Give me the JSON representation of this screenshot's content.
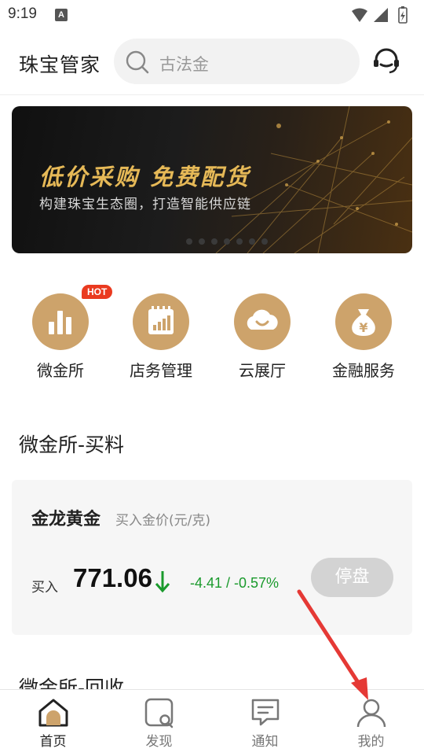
{
  "status_bar": {
    "time": "9:19",
    "notification_letter": "A"
  },
  "header": {
    "title": "珠宝管家",
    "search_placeholder": "古法金"
  },
  "banner": {
    "title": "低价采购  免费配货",
    "subtitle": "构建珠宝生态圈，打造智能供应链"
  },
  "menu": {
    "items": [
      {
        "label": "微金所",
        "badge": "HOT",
        "icon": "bar-chart-icon"
      },
      {
        "label": "店务管理",
        "icon": "calendar-chart-icon"
      },
      {
        "label": "云展厅",
        "icon": "cloud-icon"
      },
      {
        "label": "金融服务",
        "icon": "money-bag-icon"
      }
    ]
  },
  "section": {
    "title": "微金所-买料"
  },
  "gold_card": {
    "name": "金龙黄金",
    "unit_label": "买入金价(元/克)",
    "buy_label": "买入",
    "price": "771.06",
    "change": "-4.41 / -0.57%",
    "change_color": "#1a9a2c",
    "status_button": "停盘"
  },
  "next_section": {
    "title": "微金所-回收"
  },
  "tabbar": {
    "tabs": [
      {
        "label": "首页",
        "icon": "home-icon",
        "active": true
      },
      {
        "label": "发现",
        "icon": "discover-icon",
        "active": false
      },
      {
        "label": "通知",
        "icon": "message-icon",
        "active": false
      },
      {
        "label": "我的",
        "icon": "profile-icon",
        "active": false
      }
    ]
  },
  "colors": {
    "accent_gold": "#cda36b",
    "badge_red": "#ea3a1f",
    "annotation_red": "#e53935"
  }
}
